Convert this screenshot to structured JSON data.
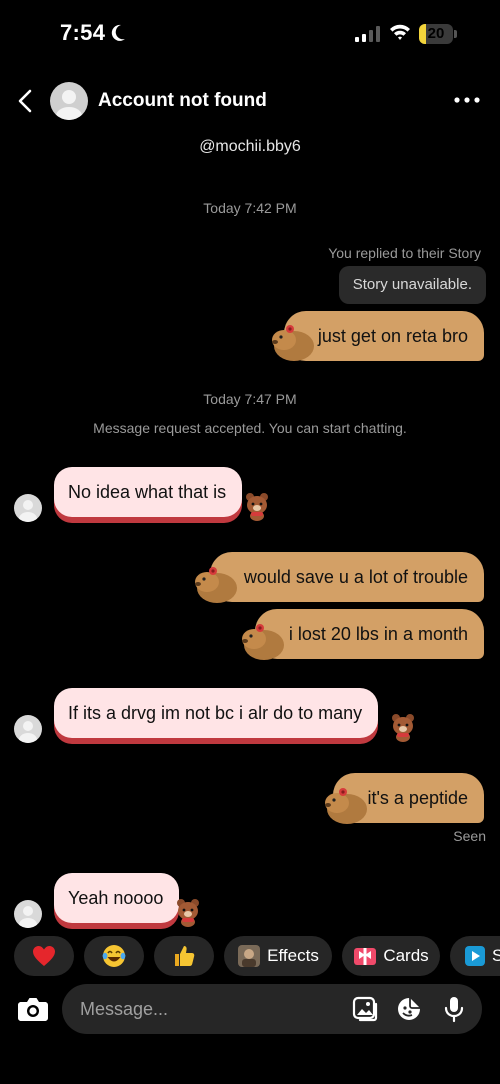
{
  "status": {
    "time": "7:54",
    "battery_level": "20",
    "battery_percent": 20
  },
  "header": {
    "title": "Account not found",
    "handle": "@mochii.bby6"
  },
  "conversation": {
    "timestamp_1": "Today 7:42 PM",
    "story_reply_note": "You replied to their Story",
    "story_unavailable": "Story unavailable.",
    "timestamp_2": "Today 7:47 PM",
    "request_accepted": "Message request accepted. You can start chatting.",
    "messages": [
      {
        "from": "me",
        "text": "just get on reta bro"
      },
      {
        "from": "them",
        "text": "No idea what that is"
      },
      {
        "from": "me",
        "text": "would save u a lot of trouble"
      },
      {
        "from": "me",
        "text": "i lost 20 lbs in a month"
      },
      {
        "from": "them",
        "text": "If its a drvg im not bc i alr do to many"
      },
      {
        "from": "me",
        "text": "it's a peptide"
      },
      {
        "from": "them",
        "text": "Yeah noooo"
      }
    ],
    "seen": "Seen"
  },
  "quick_actions": {
    "heart": "heart-emoji",
    "laugh": "tears-of-joy-emoji",
    "thumbs": "thumbs-up-emoji",
    "effects_label": "Effects",
    "cards_label": "Cards",
    "partial_label": "S"
  },
  "composer": {
    "placeholder": "Message..."
  },
  "colors": {
    "background": "#000000",
    "outgoing_bubble": "#d3a066",
    "incoming_bubble": "#ffe4e6",
    "incoming_accent": "#c0393f",
    "chip_bg": "#262626",
    "battery": "#f2d43b"
  }
}
